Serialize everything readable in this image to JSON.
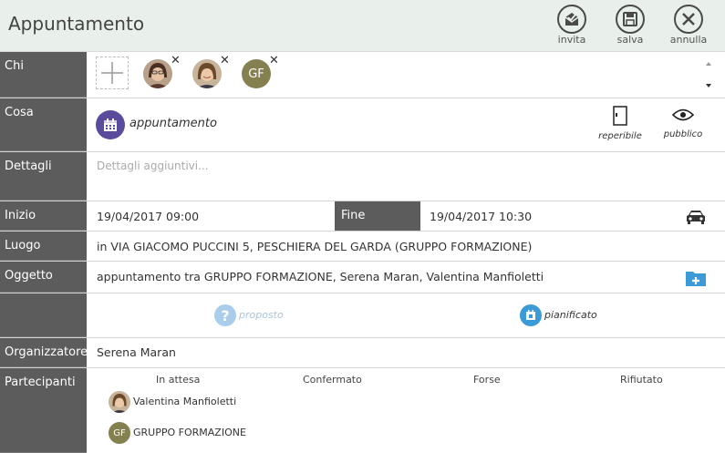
{
  "header": {
    "title": "Appuntamento",
    "buttons": [
      {
        "label": "invita"
      },
      {
        "label": "salva"
      },
      {
        "label": "annulla"
      }
    ]
  },
  "chi": {
    "label": "Chi",
    "people": [
      {
        "name": "Serena Maran"
      },
      {
        "name": "Valentina Manfioletti"
      },
      {
        "initials": "GF"
      }
    ],
    "remove_glyph": "✕"
  },
  "cosa": {
    "label": "Cosa",
    "type": "appuntamento",
    "reperibile": "reperibile",
    "pubblico": "pubblico"
  },
  "dettagli": {
    "label": "Dettagli",
    "placeholder": "Dettagli aggiuntivi..."
  },
  "inizio": {
    "label": "Inizio",
    "value": "19/04/2017 09:00"
  },
  "fine": {
    "label": "Fine",
    "value": "19/04/2017 10:30"
  },
  "luogo": {
    "label": "Luogo",
    "value": "in VIA GIACOMO PUCCINI 5, PESCHIERA DEL GARDA (GRUPPO FORMAZIONE)"
  },
  "oggetto": {
    "label": "Oggetto",
    "value": "appuntamento tra GRUPPO FORMAZIONE, Serena Maran, Valentina Manfioletti"
  },
  "stato": {
    "proposto": "proposto",
    "pianificato": "pianificato"
  },
  "organizzatore": {
    "label": "Organizzatore",
    "value": "Serena Maran"
  },
  "partecipanti": {
    "label": "Partecipanti",
    "columns": [
      "In attesa",
      "Confermato",
      "Forse",
      "Rifiutato"
    ],
    "list": [
      {
        "name": "Valentina Manfioletti"
      },
      {
        "name": "GRUPPO FORMAZIONE",
        "initials": "GF"
      }
    ]
  },
  "colors": {
    "label_bg": "#5c5c5c",
    "header_bg": "#e9efeb",
    "accent_purple": "#5a4b9c",
    "accent_blue": "#3c9ad6",
    "proposto_light": "#a9cdea",
    "gf_olive": "#85804f"
  }
}
